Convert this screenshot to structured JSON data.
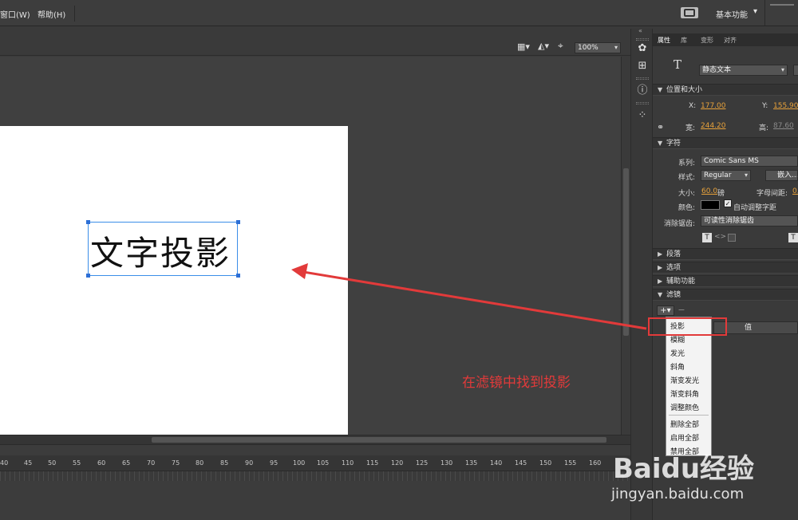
{
  "menubar": {
    "items": [
      "窗口(W)",
      "帮助(H)"
    ],
    "workspace_label": "基本功能"
  },
  "stage": {
    "zoom": "100%",
    "text": "文字投影"
  },
  "timeline": {
    "ruler": [
      "40",
      "45",
      "50",
      "55",
      "60",
      "65",
      "70",
      "75",
      "80",
      "85",
      "90",
      "95",
      "100",
      "105",
      "110",
      "115",
      "120",
      "125",
      "130",
      "135",
      "140",
      "145",
      "150",
      "155",
      "160"
    ]
  },
  "props": {
    "tabs": [
      "属性",
      "库",
      "变形",
      "对齐"
    ],
    "text_type": "静态文本",
    "position_section": "位置和大小",
    "x_label": "X:",
    "x_value": "177.00",
    "y_label": "Y:",
    "y_value": "155.90",
    "w_label": "宽:",
    "w_value": "244.20",
    "h_label": "高:",
    "h_value": "87.60",
    "char_section": "字符",
    "family_label": "系列:",
    "family_value": "Comic Sans MS",
    "style_label": "样式:",
    "style_value": "Regular",
    "embed_label": "嵌入...",
    "size_label": "大小:",
    "size_value": "60.0",
    "size_unit": "磅",
    "spacing_label": "字母间距:",
    "spacing_value": "0.",
    "color_label": "颜色:",
    "autokern_label": "自动调整字距",
    "antialias_label": "消除锯齿:",
    "antialias_value": "可读性消除锯齿",
    "para_section": "段落",
    "options_section": "选项",
    "access_section": "辅助功能",
    "filter_section": "滤镜",
    "filter_value_col": "值"
  },
  "filter_menu": {
    "items": [
      "投影",
      "模糊",
      "发光",
      "斜角",
      "渐变发光",
      "渐变斜角",
      "调整颜色",
      "删除全部",
      "启用全部",
      "禁用全部"
    ]
  },
  "annotation": {
    "note": "在滤镜中找到投影",
    "color": "#e23a3a"
  },
  "watermark": {
    "logo": "Baidu经验",
    "url": "jingyan.baidu.com"
  }
}
